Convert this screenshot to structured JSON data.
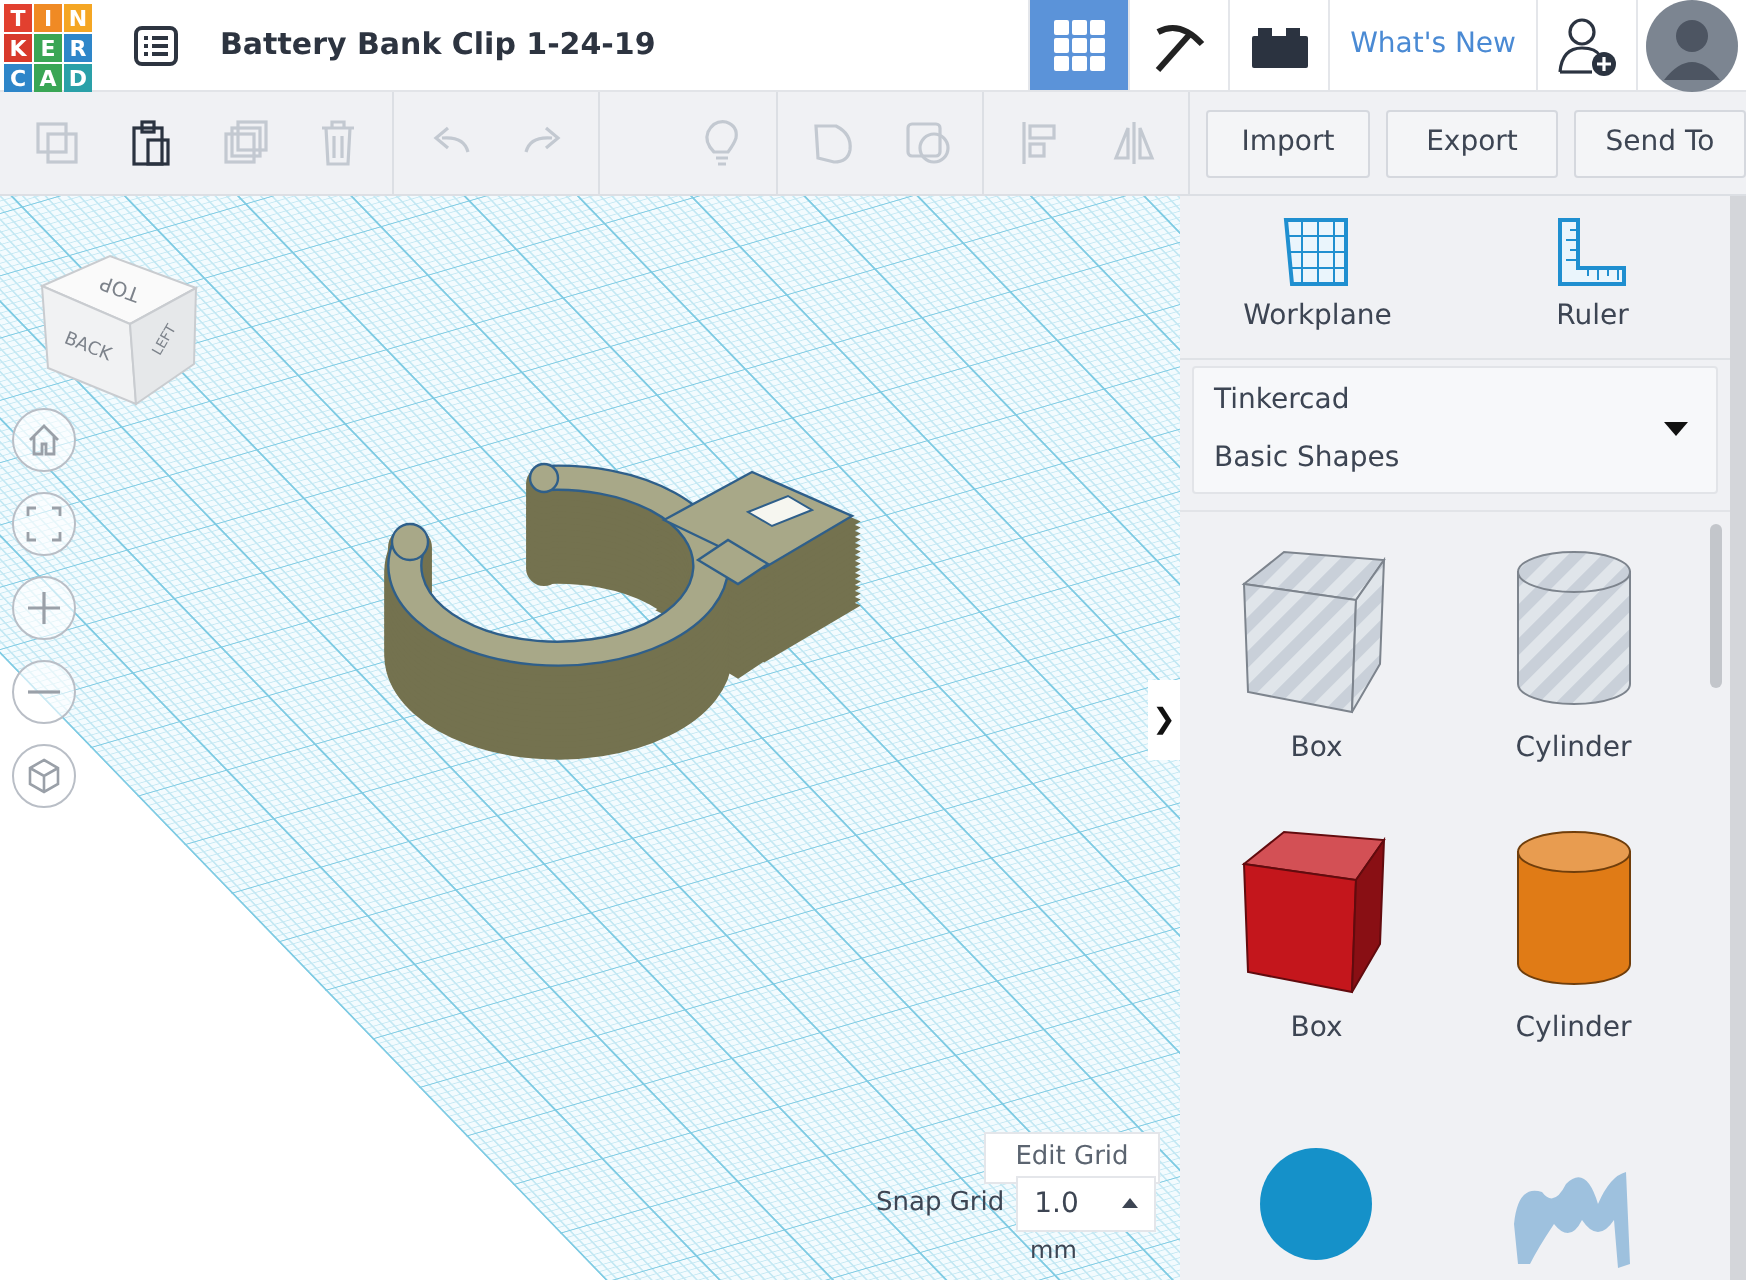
{
  "header": {
    "logo": [
      {
        "letter": "T",
        "color": "#e2402f"
      },
      {
        "letter": "I",
        "color": "#f08a24"
      },
      {
        "letter": "N",
        "color": "#f5a623"
      },
      {
        "letter": "K",
        "color": "#d8392b"
      },
      {
        "letter": "E",
        "color": "#3aa655"
      },
      {
        "letter": "R",
        "color": "#2e86c9"
      },
      {
        "letter": "C",
        "color": "#2e86c9"
      },
      {
        "letter": "A",
        "color": "#3aa655"
      },
      {
        "letter": "D",
        "color": "#2aa0a8"
      }
    ],
    "title": "Battery Bank Clip 1-24-19",
    "tabs": [
      {
        "kind": "grid",
        "selected": true
      },
      {
        "kind": "pickaxe",
        "selected": false
      },
      {
        "kind": "bricks",
        "selected": false
      }
    ],
    "whats_new": "What's New"
  },
  "toolbar": {
    "groups": [
      [
        {
          "kind": "copy",
          "disabled": true
        },
        {
          "kind": "paste",
          "disabled": false
        },
        {
          "kind": "duplicate",
          "disabled": true
        },
        {
          "kind": "delete",
          "disabled": true
        }
      ],
      [
        {
          "kind": "undo",
          "disabled": true
        },
        {
          "kind": "redo",
          "disabled": true
        }
      ],
      [
        {
          "kind": "lightbulb",
          "disabled": true
        }
      ],
      [
        {
          "kind": "shape",
          "disabled": true
        },
        {
          "kind": "hole",
          "disabled": true
        }
      ],
      [
        {
          "kind": "align",
          "disabled": true
        },
        {
          "kind": "mirror",
          "disabled": true
        }
      ]
    ],
    "buttons": [
      "Import",
      "Export",
      "Send To"
    ]
  },
  "view_cube": {
    "top": "TOP",
    "back": "BACK",
    "left": "LEFT"
  },
  "view_controls": [
    {
      "kind": "home"
    },
    {
      "kind": "fit"
    },
    {
      "kind": "zoom-in"
    },
    {
      "kind": "zoom-out"
    },
    {
      "kind": "perspective"
    }
  ],
  "edit_grid": "Edit Grid",
  "snap_grid": {
    "label": "Snap Grid",
    "value": "1.0",
    "unit": "mm"
  },
  "panel_toggle": "❯",
  "panel": {
    "tools": [
      {
        "kind": "workplane",
        "label": "Workplane"
      },
      {
        "kind": "ruler",
        "label": "Ruler"
      }
    ],
    "library": {
      "source": "Tinkercad",
      "category": "Basic Shapes"
    },
    "shapes": [
      {
        "kind": "box",
        "hole": true,
        "label": "Box"
      },
      {
        "kind": "cylinder",
        "hole": true,
        "label": "Cylinder"
      },
      {
        "kind": "box",
        "hole": false,
        "color": "#c4161c",
        "label": "Box"
      },
      {
        "kind": "cylinder",
        "hole": false,
        "color": "#e07b16",
        "label": "Cylinder"
      },
      {
        "kind": "sphere",
        "hole": false,
        "color": "#1591c9"
      },
      {
        "kind": "scribble",
        "hole": false,
        "color": "#9ec1de"
      }
    ]
  }
}
